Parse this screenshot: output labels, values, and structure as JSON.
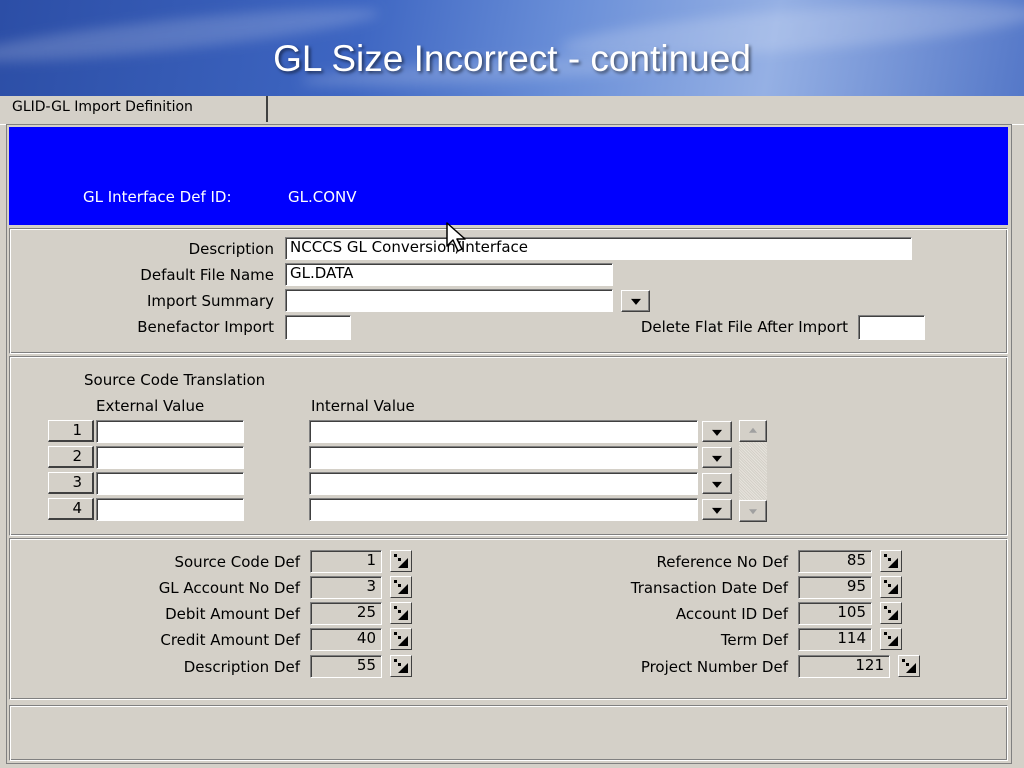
{
  "slide": {
    "title": "GL Size Incorrect - continued"
  },
  "tab": {
    "label": "GLID-GL Import Definition"
  },
  "banner": {
    "label": "GL Interface Def ID:",
    "value": "GL.CONV",
    "color": "#0000ff"
  },
  "form": {
    "description_label": "Description",
    "description_value": "NCCCS GL Conversion/Interface",
    "default_file_label": "Default File Name",
    "default_file_value": "GL.DATA",
    "import_summary_label": "Import Summary",
    "import_summary_value": "",
    "benefactor_label": "Benefactor Import",
    "benefactor_value": "",
    "delete_flat_label": "Delete Flat File After Import",
    "delete_flat_value": ""
  },
  "source_code": {
    "section_label": "Source Code Translation",
    "external_header": "External Value",
    "internal_header": "Internal Value",
    "rows": [
      {
        "num": "1",
        "external": "",
        "internal": ""
      },
      {
        "num": "2",
        "external": "",
        "internal": ""
      },
      {
        "num": "3",
        "external": "",
        "internal": ""
      },
      {
        "num": "4",
        "external": "",
        "internal": ""
      }
    ]
  },
  "defs_left": [
    {
      "label": "Source Code Def",
      "value": "1"
    },
    {
      "label": "GL Account No Def",
      "value": "3"
    },
    {
      "label": "Debit Amount Def",
      "value": "25"
    },
    {
      "label": "Credit Amount Def",
      "value": "40"
    },
    {
      "label": "Description Def",
      "value": "55"
    }
  ],
  "defs_right": [
    {
      "label": "Reference No Def",
      "value": "85"
    },
    {
      "label": "Transaction Date Def",
      "value": "95"
    },
    {
      "label": "Account ID Def",
      "value": "105"
    },
    {
      "label": "Term Def",
      "value": "114"
    },
    {
      "label": "Project Number Def",
      "value": "121"
    }
  ],
  "icons": {
    "dropdown": "chevron-down-icon",
    "zoom": "zoom-corner-icon",
    "cursor": "mouse-pointer-icon"
  }
}
